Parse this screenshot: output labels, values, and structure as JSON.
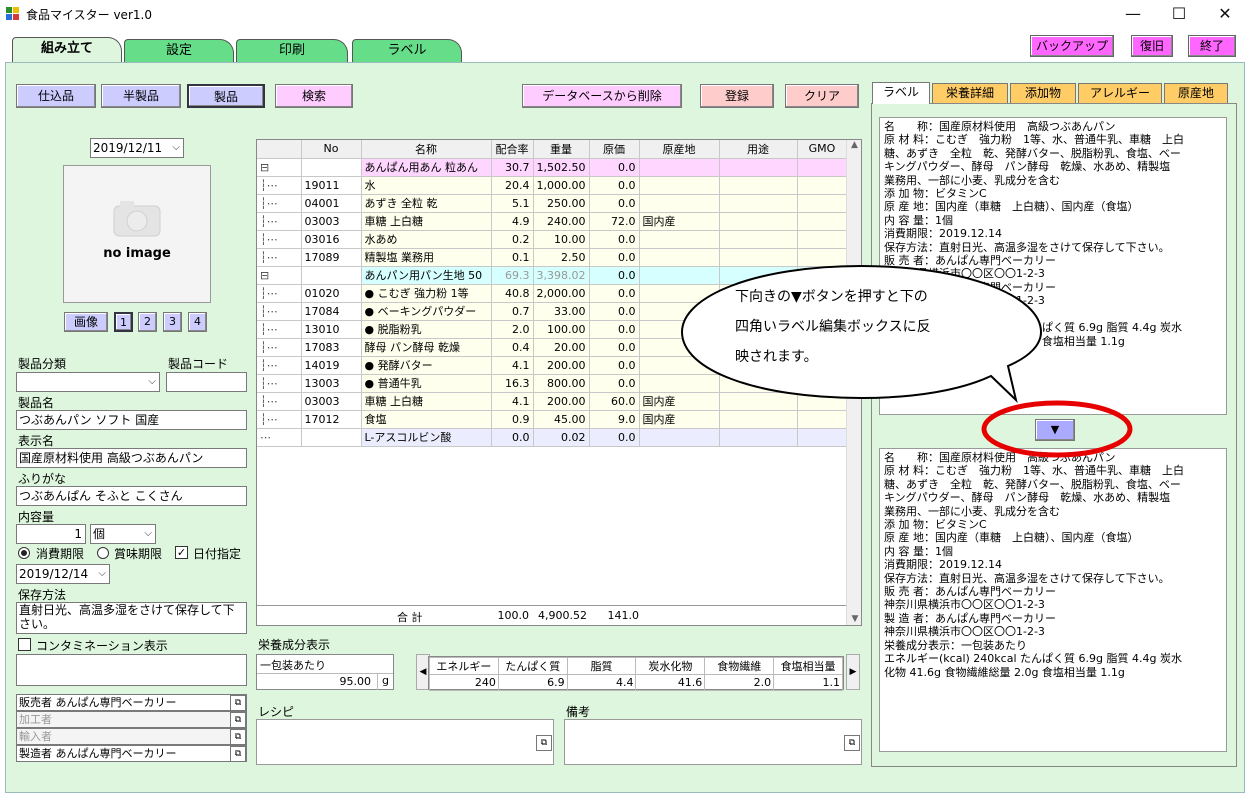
{
  "window": {
    "title": "食品マイスター ver1.0",
    "minimize": "—",
    "maximize": "☐",
    "close": "✕"
  },
  "main_tabs": [
    "組み立て",
    "設定",
    "印刷",
    "ラベル"
  ],
  "top_buttons": {
    "backup": "バックアップ",
    "restore": "復旧",
    "exit": "終了"
  },
  "toolbar": {
    "shikomi": "仕込品",
    "hanseihin": "半製品",
    "seihin": "製品",
    "search": "検索",
    "delete_db": "データベースから削除",
    "register": "登録",
    "clear": "クリア"
  },
  "left": {
    "date": "2019/12/11",
    "no_image": "no image",
    "image_label": "画像",
    "image_pages": [
      "1",
      "2",
      "3",
      "4"
    ],
    "category_label": "製品分類",
    "code_label": "製品コード",
    "name_label": "製品名",
    "name_value": "つぶあんパン ソフト 国産",
    "display_label": "表示名",
    "display_value": "国産原材料使用 高級つぶあんパン",
    "furigana_label": "ふりがな",
    "furigana_value": "つぶあんぱん そふと こくさん",
    "content_label": "内容量",
    "content_qty": "1",
    "content_unit": "個",
    "expiry_opt1": "消費期限",
    "expiry_opt2": "賞味期限",
    "date_specify": "日付指定",
    "expiry_date": "2019/12/14",
    "storage_label": "保存方法",
    "storage_value": "直射日光、高温多湿をさけて保存して下さい。",
    "contamination_label": "コンタミネーション表示",
    "seller": "販売者 あんぱん専門ベーカリー",
    "processor": "加工者",
    "importer": "輸入者",
    "manufacturer": "製造者 あんぱん専門ベーカリー"
  },
  "grid": {
    "headers": [
      "No",
      "名称",
      "配合率",
      "重量",
      "原価",
      "原産地",
      "用途",
      "GMO"
    ],
    "rows": [
      {
        "tree": "⊟",
        "no": "",
        "name": "あんぱん用あん 粒あん",
        "rate": "30.7",
        "weight": "1,502.50",
        "cost": "0.0",
        "origin": "",
        "kind": "pink"
      },
      {
        "tree": "┆⋯",
        "no": "19011",
        "name": "水",
        "rate": "20.4",
        "weight": "1,000.00",
        "cost": "0.0",
        "origin": "",
        "kind": "yellow"
      },
      {
        "tree": "┆⋯",
        "no": "04001",
        "name": "あずき 全粒 乾",
        "rate": "5.1",
        "weight": "250.00",
        "cost": "0.0",
        "origin": "",
        "kind": "yellow"
      },
      {
        "tree": "┆⋯",
        "no": "03003",
        "name": "車糖 上白糖",
        "rate": "4.9",
        "weight": "240.00",
        "cost": "72.0",
        "origin": "国内産",
        "kind": "yellow"
      },
      {
        "tree": "┆⋯",
        "no": "03016",
        "name": "水あめ",
        "rate": "0.2",
        "weight": "10.00",
        "cost": "0.0",
        "origin": "",
        "kind": "yellow"
      },
      {
        "tree": "┆⋯",
        "no": "17089",
        "name": "精製塩 業務用",
        "rate": "0.1",
        "weight": "2.50",
        "cost": "0.0",
        "origin": "",
        "kind": "yellow"
      },
      {
        "tree": "⊟",
        "no": "",
        "name": "あんパン用パン生地 50",
        "rate": "69.3",
        "weight": "3,398.02",
        "cost": "0.0",
        "origin": "",
        "kind": "cyan"
      },
      {
        "tree": "┆⋯",
        "no": "01020",
        "name": "● こむぎ 強力粉 1等",
        "rate": "40.8",
        "weight": "2,000.00",
        "cost": "0.0",
        "origin": "",
        "kind": "yellow"
      },
      {
        "tree": "┆⋯",
        "no": "17084",
        "name": "● ベーキングパウダー",
        "rate": "0.7",
        "weight": "33.00",
        "cost": "0.0",
        "origin": "",
        "kind": "yellow"
      },
      {
        "tree": "┆⋯",
        "no": "13010",
        "name": "● 脱脂粉乳",
        "rate": "2.0",
        "weight": "100.00",
        "cost": "0.0",
        "origin": "",
        "kind": "yellow"
      },
      {
        "tree": "┆⋯",
        "no": "17083",
        "name": "酵母 パン酵母 乾燥",
        "rate": "0.4",
        "weight": "20.00",
        "cost": "0.0",
        "origin": "",
        "kind": "yellow"
      },
      {
        "tree": "┆⋯",
        "no": "14019",
        "name": "● 発酵バター",
        "rate": "4.1",
        "weight": "200.00",
        "cost": "0.0",
        "origin": "",
        "kind": "yellow"
      },
      {
        "tree": "┆⋯",
        "no": "13003",
        "name": "● 普通牛乳",
        "rate": "16.3",
        "weight": "800.00",
        "cost": "0.0",
        "origin": "",
        "kind": "yellow"
      },
      {
        "tree": "┆⋯",
        "no": "03003",
        "name": "車糖 上白糖",
        "rate": "4.1",
        "weight": "200.00",
        "cost": "60.0",
        "origin": "国内産",
        "kind": "yellow"
      },
      {
        "tree": "┆⋯",
        "no": "17012",
        "name": "食塩",
        "rate": "0.9",
        "weight": "45.00",
        "cost": "9.0",
        "origin": "国内産",
        "kind": "yellow"
      },
      {
        "tree": "⋯",
        "no": "",
        "name": "L-アスコルビン酸",
        "rate": "0.0",
        "weight": "0.02",
        "cost": "0.0",
        "origin": "",
        "kind": "lav"
      }
    ],
    "total_label": "合 計",
    "total_rate": "100.0",
    "total_weight": "4,900.52",
    "total_cost": "141.0"
  },
  "nutrition": {
    "label": "栄養成分表示",
    "per_label": "一包装あたり",
    "per_value": "95.00",
    "per_unit": "g",
    "headers": [
      "エネルギー",
      "たんぱく質",
      "脂質",
      "炭水化物",
      "食物繊維",
      "食塩相当量"
    ],
    "values": [
      "240",
      "6.9",
      "4.4",
      "41.6",
      "2.0",
      "1.1"
    ]
  },
  "recipe_label": "レシピ",
  "notes_label": "備考",
  "right_tabs": [
    "ラベル",
    "栄養詳細",
    "添加物",
    "アレルギー",
    "原産地"
  ],
  "label_text_top": "名　　称：国産原材料使用　高級つぶあんパン\n原 材 料：こむぎ　強力粉　1等、水、普通牛乳、車糖　上白\n糖、あずき　全粒　乾、発酵バター、脱脂粉乳、食塩、ベー\nキングパウダー、酵母　パン酵母　乾燥、水あめ、精製塩\n業務用、一部に小麦、乳成分を含む\n添 加 物：ビタミンC\n原 産 地：国内産（車糖　上白糖）、国内産（食塩）\n内 容 量：1個\n消費期限：2019.12.14\n保存方法：直射日光、高温多湿をさけて保存して下さい。\n販 売 者：あんぱん専門ベーカリー\n神奈川県横浜市〇〇区〇〇1-2-3\n製 造 者：あんぱん専門ベーカリー\n神奈川県横浜市〇〇区〇〇1-2-3\n栄養成分表示：一包装あたり\nエネルギー(kcal) 240kcal たんぱく質 6.9g 脂質 4.4g 炭水\n化物 41.6g 食物繊維総量 2.0g 食塩相当量 1.1g",
  "label_text_bottom": "名　　称：国産原材料使用　高級つぶあんパン\n原 材 料：こむぎ　強力粉　1等、水、普通牛乳、車糖　上白\n糖、あずき　全粒　乾、発酵バター、脱脂粉乳、食塩、ベー\nキングパウダー、酵母　パン酵母　乾燥、水あめ、精製塩\n業務用、一部に小麦、乳成分を含む\n添 加 物：ビタミンC\n原 産 地：国内産（車糖　上白糖）、国内産（食塩）\n内 容 量：1個\n消費期限：2019.12.14\n保存方法：直射日光、高温多湿をさけて保存して下さい。\n販 売 者：あんぱん専門ベーカリー\n神奈川県横浜市〇〇区〇〇1-2-3\n製 造 者：あんぱん専門ベーカリー\n神奈川県横浜市〇〇区〇〇1-2-3\n栄養成分表示：一包装あたり\nエネルギー(kcal) 240kcal たんぱく質 6.9g 脂質 4.4g 炭水\n化物 41.6g 食物繊維総量 2.0g 食塩相当量 1.1g",
  "reflect_button": "▼",
  "callout": [
    "下向きの▼ボタンを押すと下の",
    "四角いラベル編集ボックスに反",
    "映されます。"
  ],
  "colors": {
    "accent_pink": "#ff66ff",
    "panel_green": "#ddf6dd",
    "highlight_red": "#e60000"
  }
}
